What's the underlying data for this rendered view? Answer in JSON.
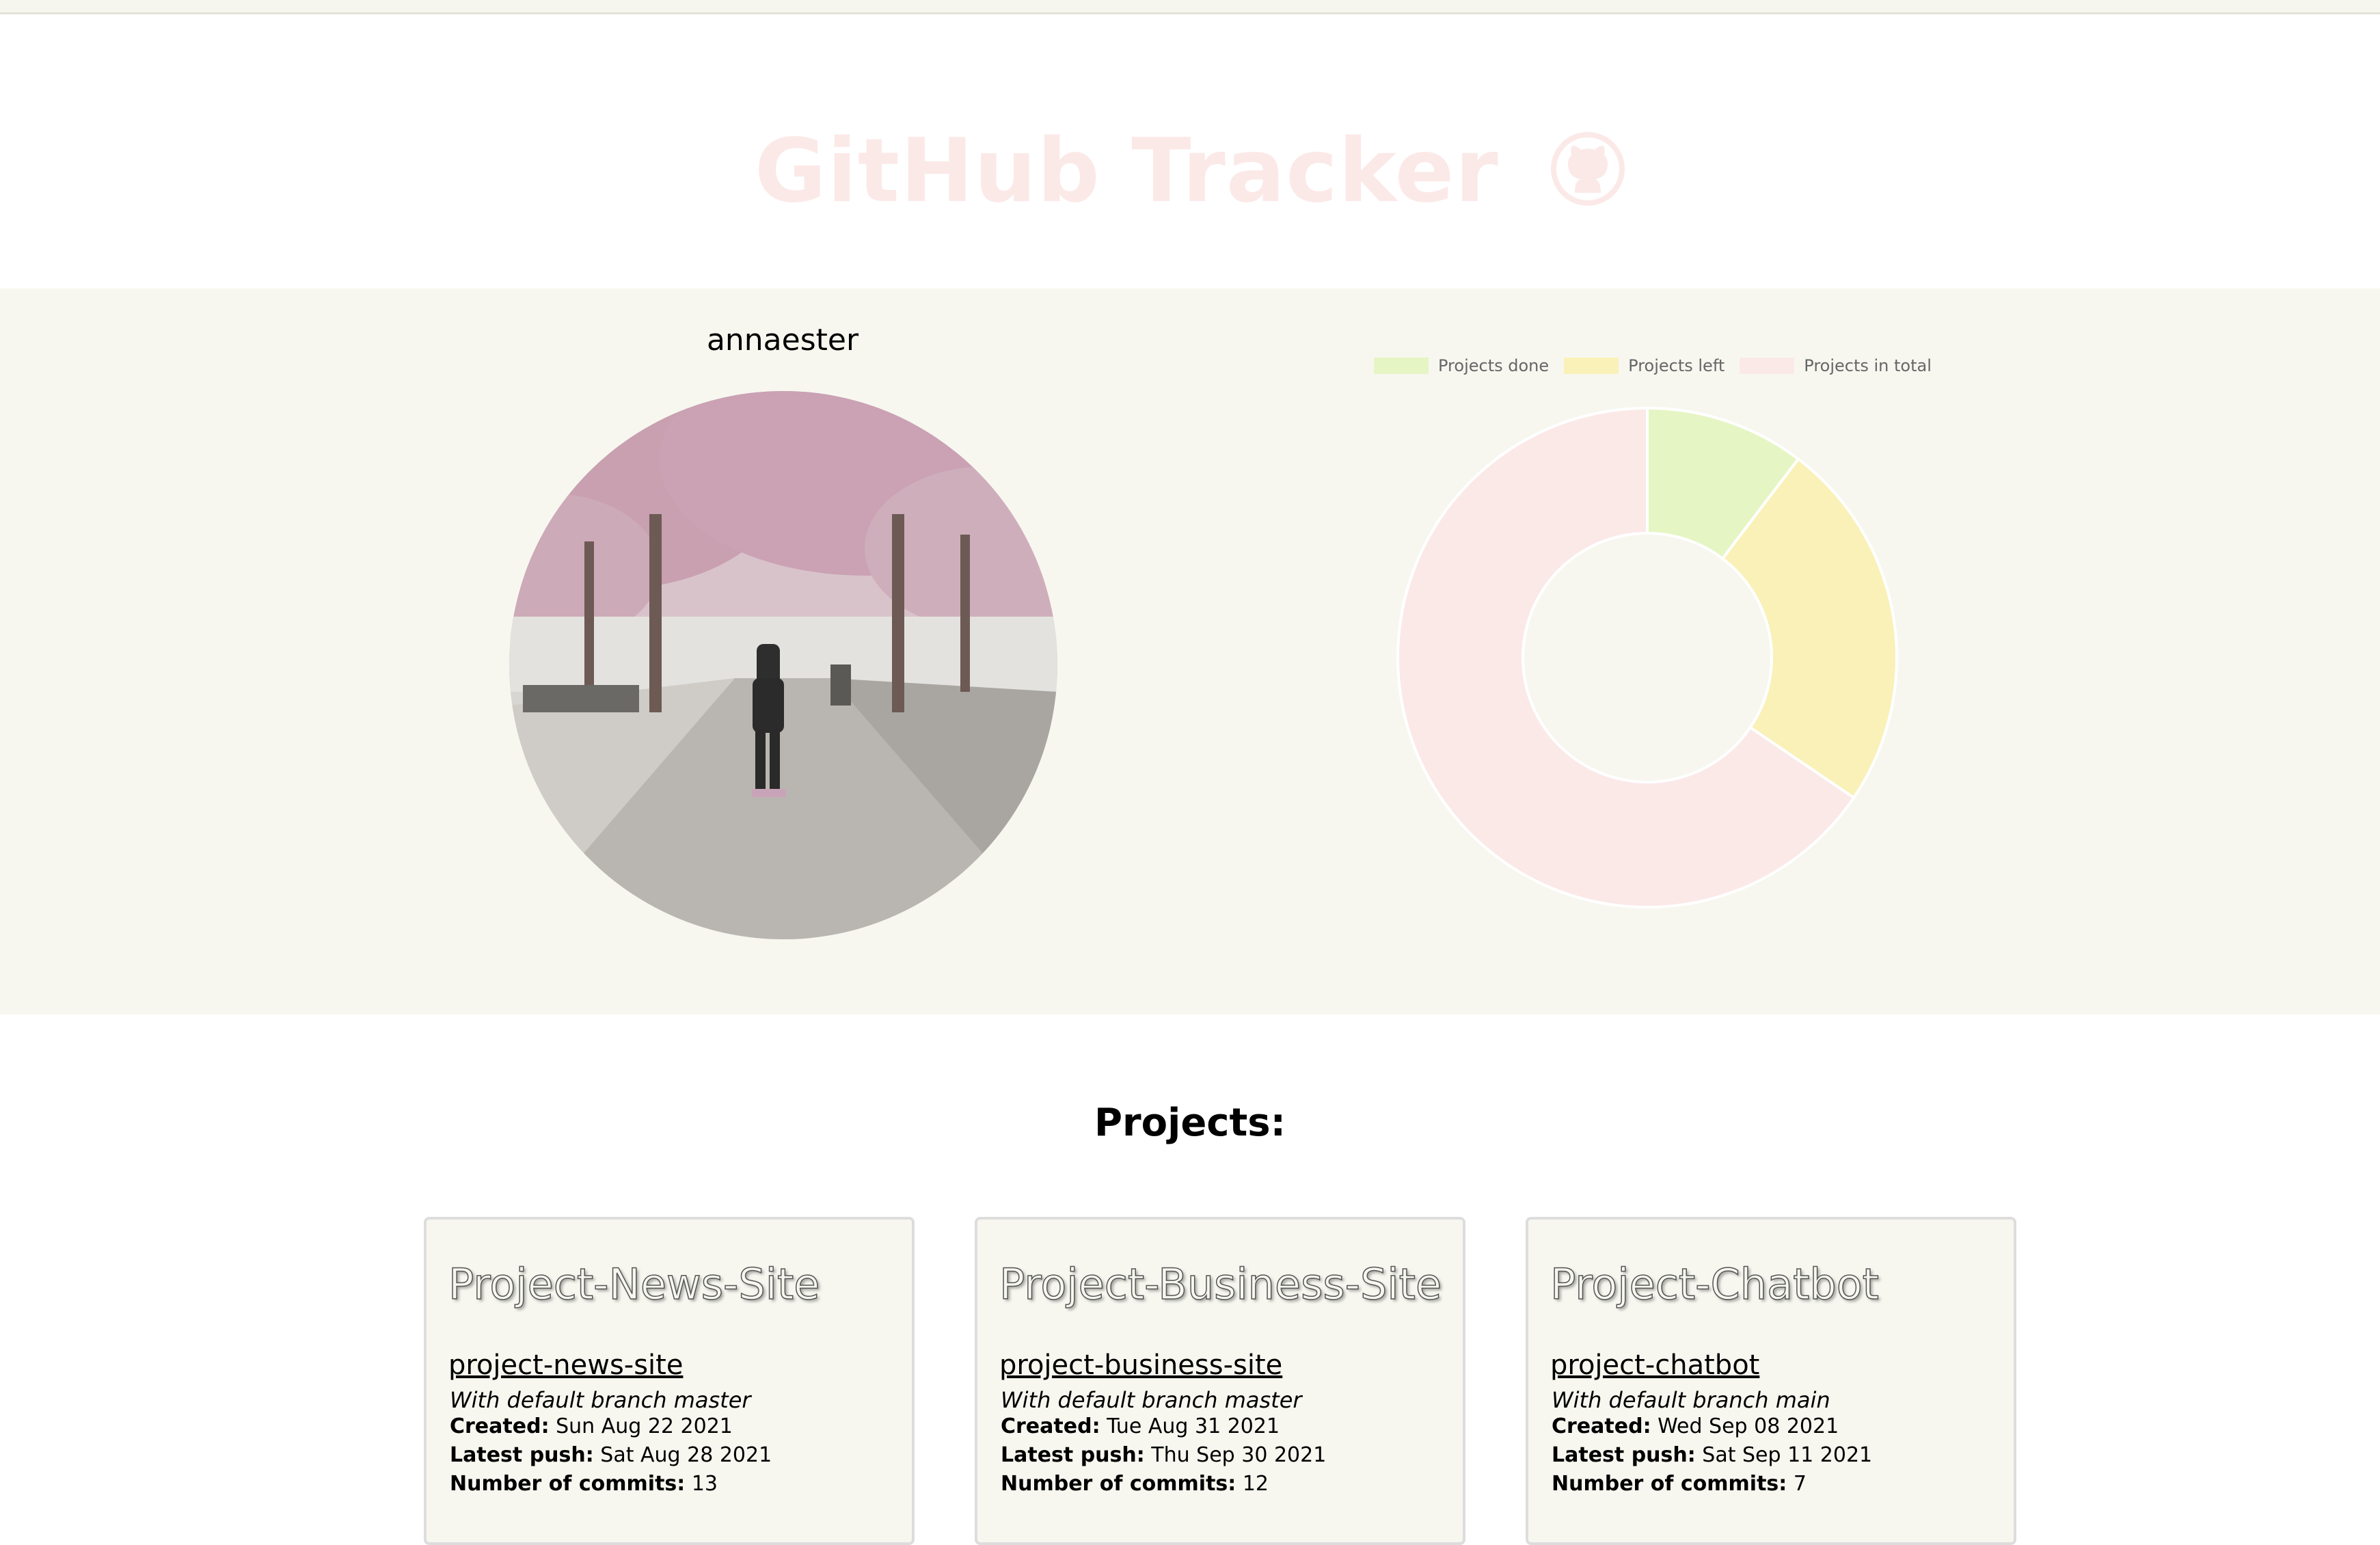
{
  "header": {
    "title": "GitHub Tracker",
    "title_color": "#fbe9e8",
    "logo_icon": "github-octocat-icon"
  },
  "profile": {
    "username": "annaester",
    "avatar_description_icon": "profile-photo"
  },
  "chart_data": {
    "type": "doughnut",
    "series": [
      {
        "name": "Projects done",
        "value": 3,
        "color": "#e6f5c4"
      },
      {
        "name": "Projects left",
        "value": 7,
        "color": "#faf1b8"
      },
      {
        "name": "Projects in total",
        "value": 19,
        "color": "#fbe9e8"
      }
    ],
    "legend_position": "top"
  },
  "projects": {
    "heading": "Projects:",
    "cards": [
      {
        "title": "Project-News-Site",
        "link": "project-news-site",
        "branch": "With default branch master",
        "created_label": "Created:",
        "created": "Sun Aug 22 2021",
        "push_label": "Latest push:",
        "push": "Sat Aug 28 2021",
        "commits_label": "Number of commits:",
        "commits": "13"
      },
      {
        "title": "Project-Business-Site",
        "link": "project-business-site",
        "branch": "With default branch master",
        "created_label": "Created:",
        "created": "Tue Aug 31 2021",
        "push_label": "Latest push:",
        "push": "Thu Sep 30 2021",
        "commits_label": "Number of commits:",
        "commits": "12"
      },
      {
        "title": "Project-Chatbot",
        "link": "project-chatbot",
        "branch": "With default branch main",
        "created_label": "Created:",
        "created": "Wed Sep 08 2021",
        "push_label": "Latest push:",
        "push": "Sat Sep 11 2021",
        "commits_label": "Number of commits:",
        "commits": "7"
      }
    ]
  }
}
